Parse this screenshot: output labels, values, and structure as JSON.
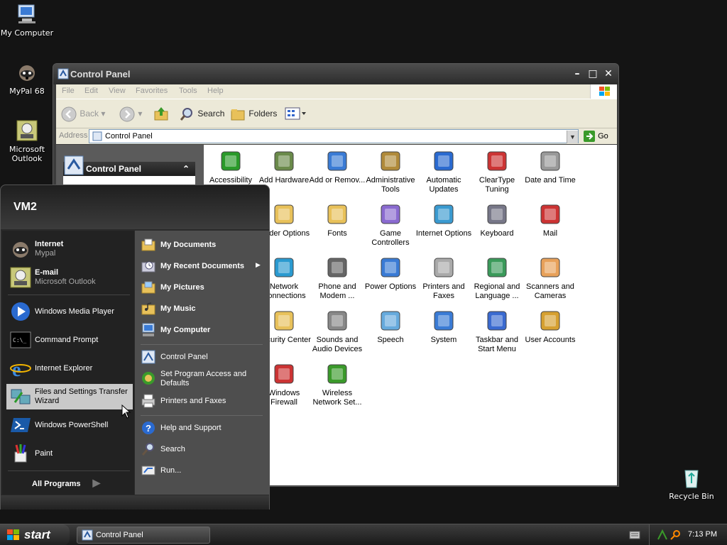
{
  "desktop": {
    "icons": [
      {
        "label": "My Computer",
        "icon": "my-computer-icon"
      },
      {
        "label": "MyPal 68",
        "icon": "mypal-icon"
      },
      {
        "label": "Microsoft Outlook",
        "icon": "outlook-icon"
      },
      {
        "label": "Recycle Bin",
        "icon": "recycle-bin-icon"
      }
    ]
  },
  "window": {
    "title": "Control Panel",
    "menu": [
      "File",
      "Edit",
      "View",
      "Favorites",
      "Tools",
      "Help"
    ],
    "toolbar": {
      "back": "Back",
      "search": "Search",
      "folders": "Folders"
    },
    "address": {
      "label": "Address",
      "value": "Control Panel",
      "go": "Go"
    },
    "left_panel": {
      "title": "Control Panel"
    },
    "items": [
      "Accessibility",
      "Add Hardware",
      "Add or Remov...",
      "Administrative Tools",
      "Automatic Updates",
      "ClearType Tuning",
      "Date and Time",
      "Folder Options",
      "Fonts",
      "Game Controllers",
      "Internet Options",
      "Keyboard",
      "Mail",
      "Network Connections",
      "Phone and Modem ...",
      "Power Options",
      "Printers and Faxes",
      "Regional and Language ...",
      "Scanners and Cameras",
      "Security Center",
      "Sounds and Audio Devices",
      "Speech",
      "System",
      "Taskbar and Start Menu",
      "User Accounts",
      "Windows Firewall",
      "Wireless Network Set..."
    ]
  },
  "start_menu": {
    "user": "VM2",
    "pinned": [
      {
        "title": "Internet",
        "sub": "Mypal"
      },
      {
        "title": "E-mail",
        "sub": "Microsoft Outlook"
      }
    ],
    "recent": [
      "Windows Media Player",
      "Command Prompt",
      "Internet Explorer",
      "Files and Settings Transfer Wizard",
      "Windows PowerShell",
      "Paint"
    ],
    "all_programs": "All Programs",
    "right": {
      "places": [
        "My Documents",
        "My Recent Documents",
        "My Pictures",
        "My Music",
        "My Computer"
      ],
      "settings": [
        "Control Panel",
        "Set Program Access and Defaults",
        "Printers and Faxes"
      ],
      "help": [
        "Help and Support",
        "Search",
        "Run..."
      ]
    }
  },
  "taskbar": {
    "start": "start",
    "task": "Control Panel",
    "clock": "7:13 PM"
  }
}
